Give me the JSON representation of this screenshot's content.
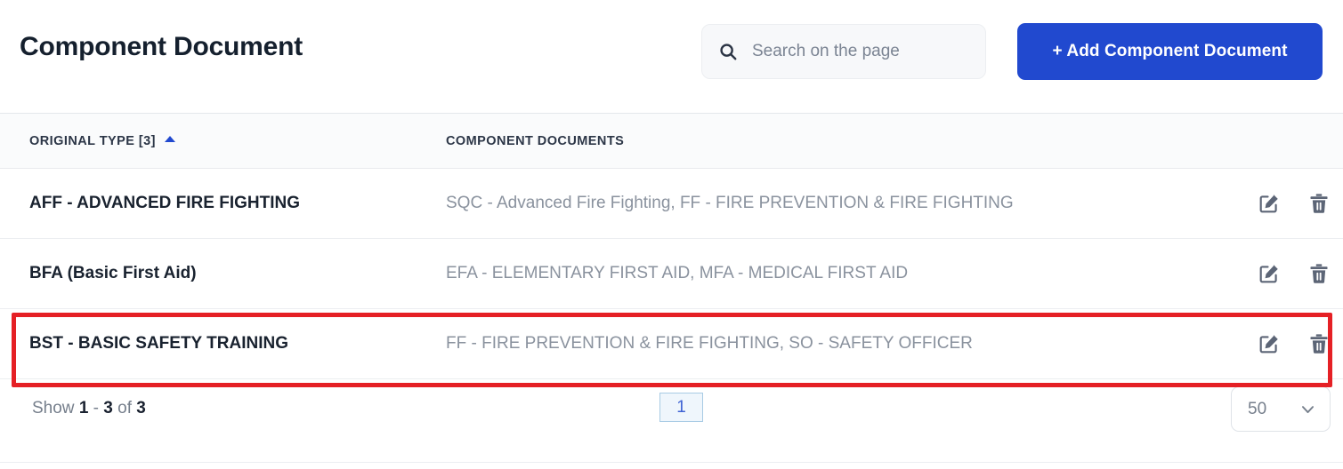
{
  "header": {
    "title": "Component Document",
    "search": {
      "placeholder": "Search on the page",
      "value": "",
      "icon": "search-icon"
    },
    "add_button": {
      "label": "+ Add Component Document",
      "color": "#2149cf"
    }
  },
  "table": {
    "columns": [
      {
        "key": "original_type",
        "label": "ORIGINAL TYPE [3]",
        "sorted": "asc",
        "sort_icon": "caret-up-icon"
      },
      {
        "key": "component_documents",
        "label": "COMPONENT DOCUMENTS",
        "sorted": "none"
      }
    ],
    "rows": [
      {
        "original_type": "AFF - ADVANCED FIRE FIGHTING",
        "component_documents": "SQC - Advanced Fire Fighting, FF - FIRE PREVENTION & FIRE FIGHTING",
        "highlighted": false
      },
      {
        "original_type": "BFA (Basic First Aid)",
        "component_documents": "EFA - ELEMENTARY FIRST AID, MFA - MEDICAL FIRST AID",
        "highlighted": false
      },
      {
        "original_type": "BST - BASIC SAFETY TRAINING",
        "component_documents": "FF - FIRE PREVENTION & FIRE FIGHTING, SO - SAFETY OFFICER",
        "highlighted": true
      }
    ],
    "row_actions": {
      "edit_icon": "edit-pencil-icon",
      "delete_icon": "trash-icon"
    },
    "highlight_color": "#e52025"
  },
  "footer": {
    "show_prefix": "Show",
    "range_from": "1",
    "range_dash": "-",
    "range_to": "3",
    "of_label": "of",
    "total": "3",
    "pagination": {
      "current_page": "1"
    },
    "page_size": {
      "value": "50",
      "icon": "chevron-down-icon"
    }
  }
}
